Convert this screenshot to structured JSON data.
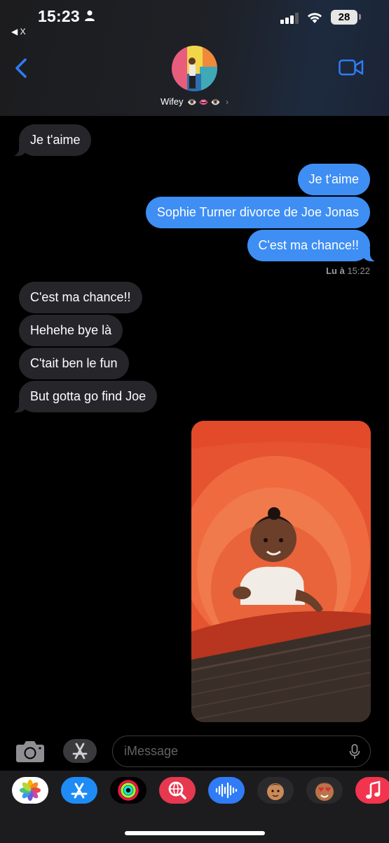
{
  "status_bar": {
    "time": "15:23",
    "back_app": "X",
    "battery": "28"
  },
  "header": {
    "contact_name": "Wifey",
    "contact_emojis": "👁️ 👄 👁️"
  },
  "messages": [
    {
      "direction": "incoming",
      "text": "Je t'aime"
    },
    {
      "direction": "outgoing",
      "text": "Je t'aime"
    },
    {
      "direction": "outgoing",
      "text": "Sophie Turner divorce de Joe Jonas"
    },
    {
      "direction": "outgoing",
      "text": "C'est ma chance!!"
    },
    {
      "direction": "incoming",
      "text": "C'est ma chance!!"
    },
    {
      "direction": "incoming",
      "text": "Hehehe bye là"
    },
    {
      "direction": "incoming",
      "text": "C'tait ben le fun"
    },
    {
      "direction": "incoming",
      "text": "But gotta go find Joe"
    }
  ],
  "read_receipt": {
    "label": "Lu à",
    "time": "15:22"
  },
  "compose": {
    "placeholder": "iMessage"
  },
  "app_drawer": [
    "photos-app",
    "app-store-app",
    "activity-app",
    "images-search-app",
    "audio-message-app",
    "memoji-app",
    "animoji-app",
    "music-app"
  ],
  "colors": {
    "outgoing_bubble": "#3e8ef4",
    "incoming_bubble": "#26252a",
    "accent": "#2f7cf6"
  }
}
